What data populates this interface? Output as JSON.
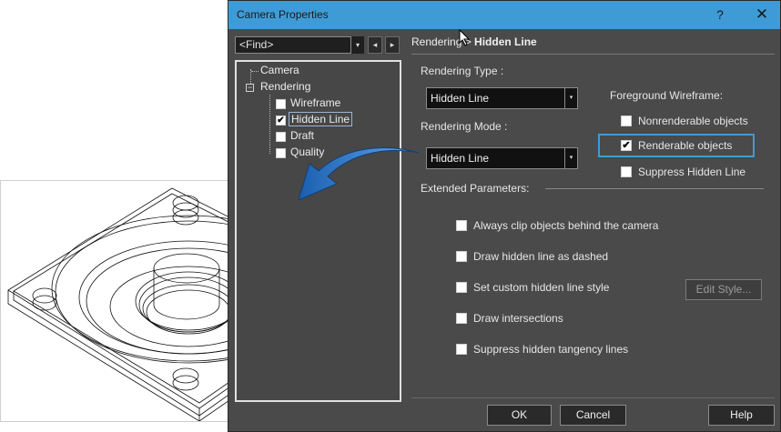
{
  "window": {
    "title": "Camera Properties",
    "help_glyph": "?",
    "close_glyph": "✕"
  },
  "find": {
    "value": "<Find>",
    "dropdown_glyph": "▾",
    "prev_glyph": "◂",
    "next_glyph": "▸"
  },
  "tree": {
    "items": [
      {
        "label": "Camera"
      },
      {
        "label": "Rendering",
        "expander": "−"
      },
      {
        "label": "Wireframe",
        "checked": false
      },
      {
        "label": "Hidden Line",
        "checked": true,
        "selected": true
      },
      {
        "label": "Draft",
        "checked": false
      },
      {
        "label": "Quality",
        "checked": false
      }
    ]
  },
  "panel": {
    "header_prefix": "Rendering > ",
    "header_current": "Hidden Line",
    "rendering_type_label": "Rendering Type :",
    "rendering_type_value": "Hidden Line",
    "rendering_mode_label": "Rendering Mode :",
    "rendering_mode_value": "Hidden Line",
    "combo_arrow": "▾",
    "foreground_wireframe_label": "Foreground Wireframe:",
    "foreground_options": [
      {
        "label": "Nonrenderable objects",
        "checked": false
      },
      {
        "label": "Renderable objects",
        "checked": true
      },
      {
        "label": "Suppress Hidden Line",
        "checked": false
      }
    ],
    "extended_label": "Extended Parameters:",
    "extended_options": [
      {
        "label": "Always clip objects behind the camera",
        "checked": false
      },
      {
        "label": "Draw hidden line as dashed",
        "checked": false
      },
      {
        "label": "Set custom hidden line style",
        "checked": false
      },
      {
        "label": "Draw intersections",
        "checked": false
      },
      {
        "label": "Suppress hidden tangency lines",
        "checked": false
      }
    ],
    "edit_style_label": "Edit Style..."
  },
  "footer": {
    "ok_label": "OK",
    "cancel_label": "Cancel",
    "help_label": "Help"
  },
  "colors": {
    "accent": "#3f9bd6",
    "dialog_bg": "#4a4a4a",
    "arrow_blue": "#1e6fc4"
  },
  "icons": {
    "check": "✔"
  }
}
